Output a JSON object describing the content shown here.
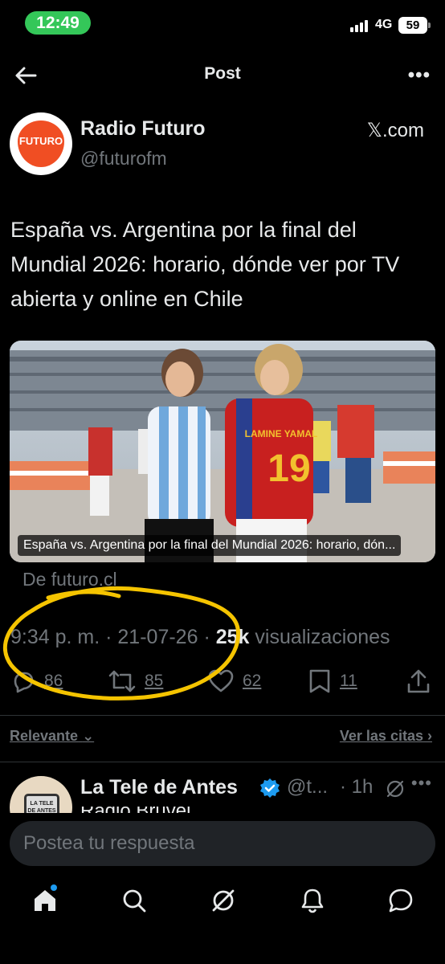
{
  "status_bar": {
    "time": "12:49",
    "network": "4G",
    "battery": "59"
  },
  "header": {
    "title": "Post"
  },
  "post": {
    "author_name": "Radio Futuro",
    "author_handle": "@futurofm",
    "avatar_logo_text": "FUTURO",
    "source_label": "𝕏.com",
    "text": "España vs. Argentina por la final del Mundial 2026: horario, dónde ver por TV abierta y online en Chile",
    "card": {
      "caption": "España vs. Argentina por la final del Mundial 2026: horario, dón...",
      "domain": "De futuro.cl",
      "jersey_spain": "LAMINE YAMAL",
      "jersey_number": "19"
    },
    "time": "9:34 p. m.",
    "date": "21-07-26",
    "views_count": "25k",
    "views_label": "visualizaciones",
    "replies": "86",
    "reposts": "85",
    "likes": "62",
    "bookmarks": "11"
  },
  "replies_section": {
    "sort_label": "Relevante",
    "quotes_link": "Ver las citas"
  },
  "reply_preview": {
    "author_name": "La Tele de Antes",
    "handle": "@t...",
    "time": "· 1h",
    "avatar_text": "LA TELE DE ANTES",
    "text_peek": "Radio Bruvel"
  },
  "composer": {
    "placeholder": "Postea tu respuesta"
  },
  "tabs": [
    "home-icon",
    "search-icon",
    "grok-icon",
    "notifications-icon",
    "messages-icon"
  ],
  "colors": {
    "background": "#000000",
    "text": "#e7e9ea",
    "muted": "#71767b",
    "accent": "#1d9bf0",
    "annotation": "#f5c400",
    "status_time_pill": "#34c759"
  }
}
